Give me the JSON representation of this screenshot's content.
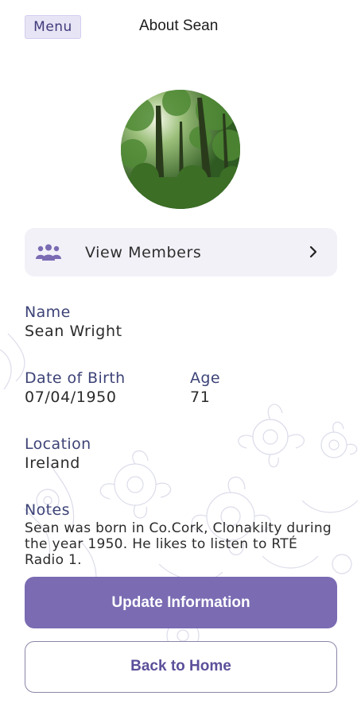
{
  "header": {
    "menu_label": "Menu",
    "title": "About Sean"
  },
  "members": {
    "label": "View Members",
    "icon": "group-icon",
    "chevron": "chevron-right-icon"
  },
  "profile": {
    "name_label": "Name",
    "name_value": "Sean Wright",
    "dob_label": "Date of Birth",
    "dob_value": "07/04/1950",
    "age_label": "Age",
    "age_value": "71",
    "location_label": "Location",
    "location_value": "Ireland",
    "notes_label": "Notes",
    "notes_value": "Sean was born in Co.Cork, Clonakilty during the year 1950. He likes to listen to RTÉ Radio 1."
  },
  "actions": {
    "update_label": "Update Information",
    "home_label": "Back to Home"
  },
  "colors": {
    "accent": "#7a6bb3",
    "label_text": "#3d4377",
    "card_bg": "#f2f1f8"
  }
}
